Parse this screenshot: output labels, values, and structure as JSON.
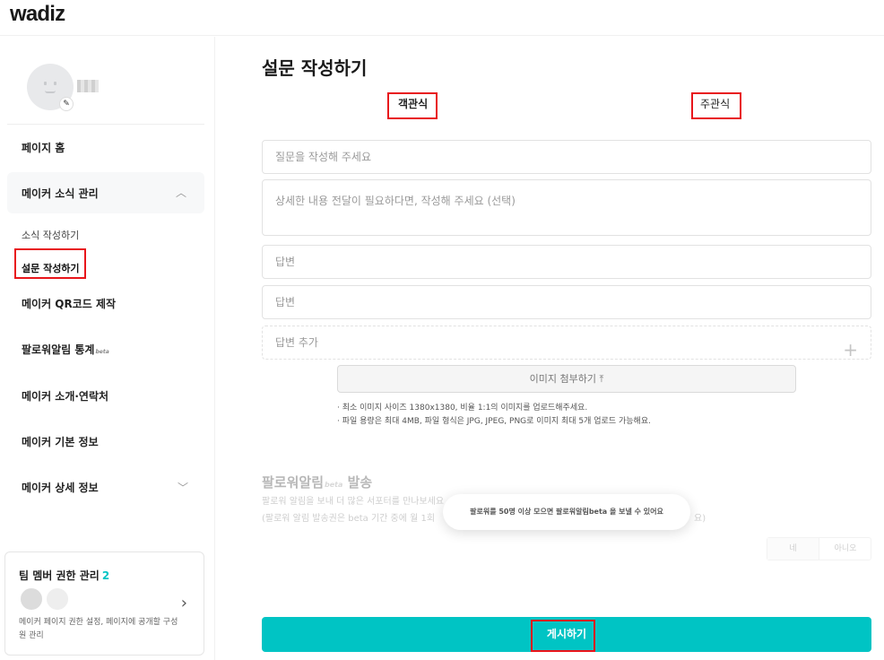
{
  "brand": {
    "logo": "wadiz",
    "accent": "#00c4c4",
    "highlight": "#e8151b"
  },
  "sidebar": {
    "nav": {
      "home": "페이지 홈",
      "news_group": "메이커 소식 관리",
      "news_sub_write": "소식 작성하기",
      "news_sub_survey": "설문 작성하기",
      "qr": "메이커 QR코드 제작",
      "follow_stats": "팔로워알림 통계",
      "follow_stats_beta": "beta",
      "intro_contact": "메이커 소개·연락처",
      "basic_info": "메이커 기본 정보",
      "detail_info": "메이커 상세 정보"
    },
    "team": {
      "title": "팀 멤버 권한 관리",
      "count": "2",
      "desc": "메이커 페이지 권한 설정, 페이지에 공개할 구성원 관리"
    }
  },
  "main": {
    "title": "설문 작성하기",
    "tabs": {
      "objective": "객관식",
      "subjective": "주관식"
    },
    "question_placeholder": "질문을 작성해 주세요",
    "detail_placeholder": "상세한 내용 전달이 필요하다면, 작성해 주세요 (선택)",
    "answer_1_placeholder": "답변",
    "answer_2_placeholder": "답변",
    "add_answer": "답변 추가",
    "upload_button": "이미지 첨부하기 ⤒",
    "notes": [
      "· 최소 이미지 사이즈 1380x1380, 비율 1:1의 이미지를 업로드해주세요.",
      "· 파일 용량은 최대 4MB, 파일 형식은 JPG, JPEG, PNG로 이미지 최대 5개 업로드 가능해요."
    ],
    "follow": {
      "title": "팔로워알림",
      "title_beta": "beta",
      "title_suffix": " 발송",
      "desc_1": "팔로워 알림을 보내 더 많은 서포터를 만나보세요",
      "desc_2": "(팔로워 알림 발송권은 beta 기간 중에 월 1회",
      "desc_2_tail": "요)",
      "yes": "네",
      "no": "아니오"
    },
    "toast": "팔로워를 50명 이상 모으면 팔로워알림beta 을 보낼 수 있어요",
    "submit": "게시하기"
  }
}
